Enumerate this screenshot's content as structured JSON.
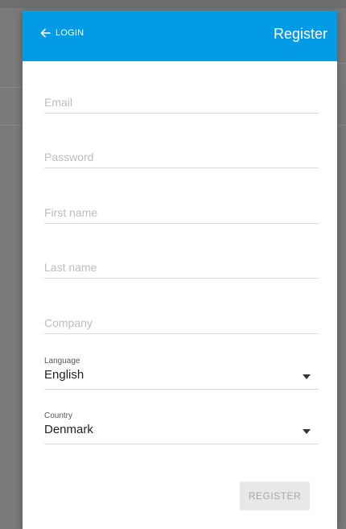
{
  "header": {
    "back_label": "LOGIN",
    "title": "Register",
    "background_color": "#039be5"
  },
  "form": {
    "email_placeholder": "Email",
    "password_placeholder": "Password",
    "first_name_placeholder": "First name",
    "last_name_placeholder": "Last name",
    "company_placeholder": "Company",
    "language": {
      "label": "Language",
      "value": "English"
    },
    "country": {
      "label": "Country",
      "value": "Denmark"
    }
  },
  "actions": {
    "register_label": "REGISTER"
  },
  "icons": {
    "back": "arrow-left-icon",
    "dropdown": "caret-down-icon"
  }
}
